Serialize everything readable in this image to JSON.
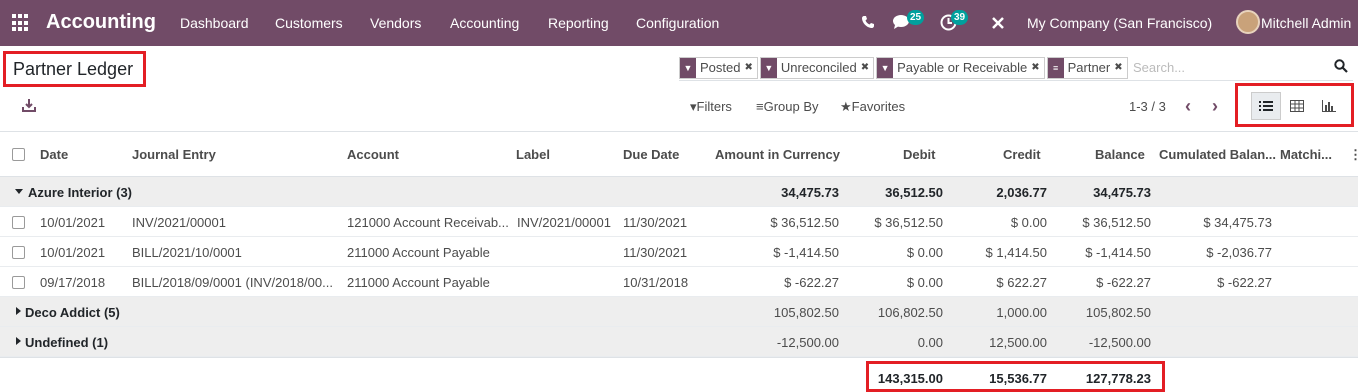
{
  "navbar": {
    "brand": "Accounting",
    "menu": [
      "Dashboard",
      "Customers",
      "Vendors",
      "Accounting",
      "Reporting",
      "Configuration"
    ],
    "messages_count": "25",
    "activities_count": "39",
    "company": "My Company (San Francisco)",
    "user": "Mitchell Admin",
    "icons": [
      "apps-icon",
      "phone-icon",
      "chat-icon",
      "clock-icon",
      "tools-icon"
    ]
  },
  "control": {
    "title": "Partner Ledger",
    "facets": [
      {
        "icon": "filter-icon",
        "label": "Posted"
      },
      {
        "icon": "filter-icon",
        "label": "Unreconciled"
      },
      {
        "icon": "filter-icon",
        "label": "Payable or Receivable"
      },
      {
        "icon": "group-icon",
        "label": "Partner"
      }
    ],
    "search_placeholder": "Search...",
    "filters": "Filters",
    "group_by": "Group By",
    "favorites": "Favorites",
    "pager": "1-3 / 3",
    "views": [
      "list-view-icon",
      "pivot-view-icon",
      "graph-view-icon"
    ]
  },
  "table": {
    "headers": [
      "Date",
      "Journal Entry",
      "Account",
      "Label",
      "Due Date",
      "Amount in Currency",
      "Debit",
      "Credit",
      "Balance",
      "Cumulated Balan...",
      "Matchi..."
    ],
    "groups": [
      {
        "name": "Azure Interior (3)",
        "amount_currency": "34,475.73",
        "debit": "36,512.50",
        "credit": "2,036.77",
        "balance": "34,475.73",
        "expanded": true,
        "rows": [
          {
            "date": "10/01/2021",
            "entry": "INV/2021/00001",
            "account": "121000 Account Receivab...",
            "label": "INV/2021/00001",
            "due": "11/30/2021",
            "amount_currency": "$ 36,512.50",
            "debit": "$ 36,512.50",
            "credit": "$ 0.00",
            "balance": "$ 36,512.50",
            "cumulated": "$ 34,475.73"
          },
          {
            "date": "10/01/2021",
            "entry": "BILL/2021/10/0001",
            "account": "211000 Account Payable",
            "label": "",
            "due": "11/30/2021",
            "amount_currency": "$ -1,414.50",
            "debit": "$ 0.00",
            "credit": "$ 1,414.50",
            "balance": "$ -1,414.50",
            "cumulated": "$ -2,036.77"
          },
          {
            "date": "09/17/2018",
            "entry": "BILL/2018/09/0001 (INV/2018/00...",
            "account": "211000 Account Payable",
            "label": "",
            "due": "10/31/2018",
            "amount_currency": "$ -622.27",
            "debit": "$ 0.00",
            "credit": "$ 622.27",
            "balance": "$ -622.27",
            "cumulated": "$ -622.27"
          }
        ]
      },
      {
        "name": "Deco Addict (5)",
        "amount_currency": "105,802.50",
        "debit": "106,802.50",
        "credit": "1,000.00",
        "balance": "105,802.50",
        "expanded": false
      },
      {
        "name": "Undefined (1)",
        "amount_currency": "-12,500.00",
        "debit": "0.00",
        "credit": "12,500.00",
        "balance": "-12,500.00",
        "expanded": false
      }
    ],
    "totals": {
      "debit": "143,315.00",
      "credit": "15,536.77",
      "balance": "127,778.23"
    }
  },
  "colors": {
    "brand": "#714b67",
    "highlight": "#e31e24",
    "messages_badge": "#00a09d",
    "activities_badge": "#00a09d"
  }
}
